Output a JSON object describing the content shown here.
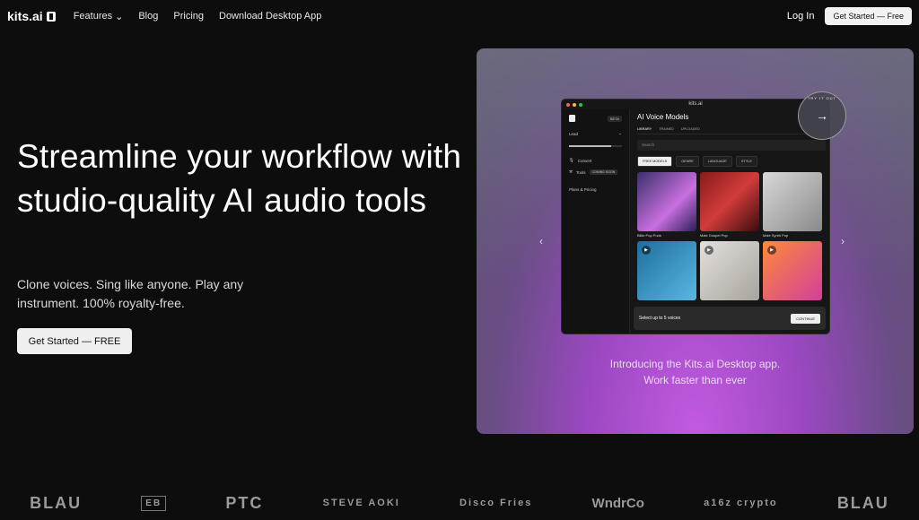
{
  "nav": {
    "brand": "kits.ai",
    "links": [
      "Features",
      "Blog",
      "Pricing",
      "Download Desktop App"
    ],
    "login": "Log In",
    "cta": "Get Started — Free"
  },
  "hero": {
    "title": "Streamline your workflow with studio-quality AI audio tools",
    "subtitle": "Clone voices. Sing like anyone. Play any instrument.  100% royalty-free.",
    "cta": "Get Started — FREE"
  },
  "showcase": {
    "app_title": "kits.ai",
    "heading": "AI Voice Models",
    "tabs": [
      "LIBRARY",
      "TRAINED",
      "UPLOADED"
    ],
    "search_placeholder": "Search",
    "filters": [
      "FREE MODELS",
      "GENRE",
      "LANGUAGE",
      "STYLE"
    ],
    "sidebar": {
      "badge": "BETA",
      "workspace": "Lead",
      "items": [
        "Convert",
        "Tools",
        "Plans & Pricing"
      ],
      "tools_pill": "COMING SOON"
    },
    "cards": [
      "Billie Pop Punk",
      "Male Gospel Pop",
      "Male Synth Pop"
    ],
    "toast": "Select up to 5 voices",
    "toast_button": "CONTINUE",
    "badge_text": "TRY IT OUT",
    "caption_line1": "Introducing the Kits.ai Desktop app.",
    "caption_line2": "Work faster than ever"
  },
  "partners": [
    "BLAU",
    "EB",
    "PTC",
    "STEVE AOKI",
    "Disco Fries",
    "WndrCo",
    "a16z crypto",
    "BLAU"
  ]
}
